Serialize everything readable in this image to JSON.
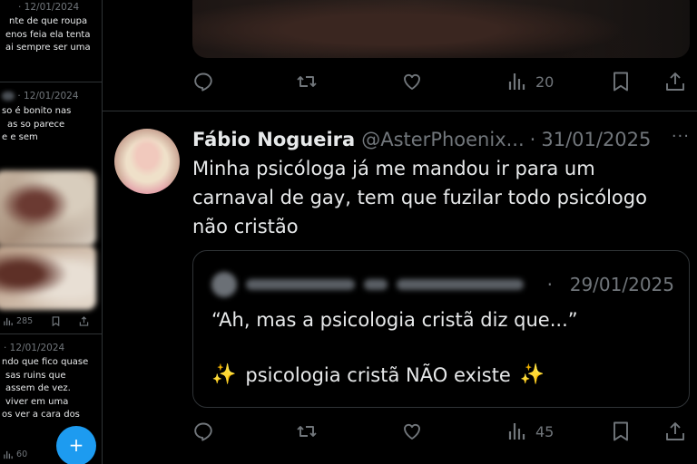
{
  "colors": {
    "background": "#000000",
    "text": "#e7e9ea",
    "muted": "#71767b",
    "border": "#2f3336",
    "accent": "#1d9bf0",
    "sparkle": "#f7c948"
  },
  "side": {
    "item1": {
      "date": "· 12/01/2024",
      "lines": [
        "nte de que roupa",
        "enos feia ela tenta",
        "ai sempre ser uma"
      ]
    },
    "item2": {
      "date": "· 12/01/2024",
      "lines": [
        "so é bonito nas",
        "as so parece",
        "e e sem"
      ]
    },
    "item2_stats": {
      "views": "285"
    },
    "item3": {
      "date": "· 12/01/2024",
      "lines": [
        "ndo que fico quase",
        "sas ruins que",
        "assem de vez.",
        "viver em uma",
        "os ver a cara dos"
      ]
    },
    "item3_stats": {
      "views": "60"
    },
    "fab_label": "+"
  },
  "previous_tweet": {
    "actions": {
      "views": "20"
    }
  },
  "tweet": {
    "author_name": "Fábio Nogueira",
    "author_handle": "@AsterPhoenix...",
    "separator": "·",
    "date": "31/01/2025",
    "more": "···",
    "text_lines": [
      "Minha psicóloga já me mandou ir para um",
      "carnaval de gay, tem que fuzilar todo psicólogo",
      "não cristão"
    ],
    "quote": {
      "separator": "·",
      "date": "29/01/2025",
      "line1": "“Ah, mas a psicologia cristã diz que...”",
      "sparkle": "✨",
      "line2": "psicologia cristã NÃO existe"
    },
    "actions": {
      "views": "45"
    }
  },
  "icons": [
    "reply-icon",
    "retweet-icon",
    "like-icon",
    "views-icon",
    "bookmark-icon",
    "share-icon",
    "more-icon",
    "sparkle-icon",
    "compose-icon"
  ]
}
